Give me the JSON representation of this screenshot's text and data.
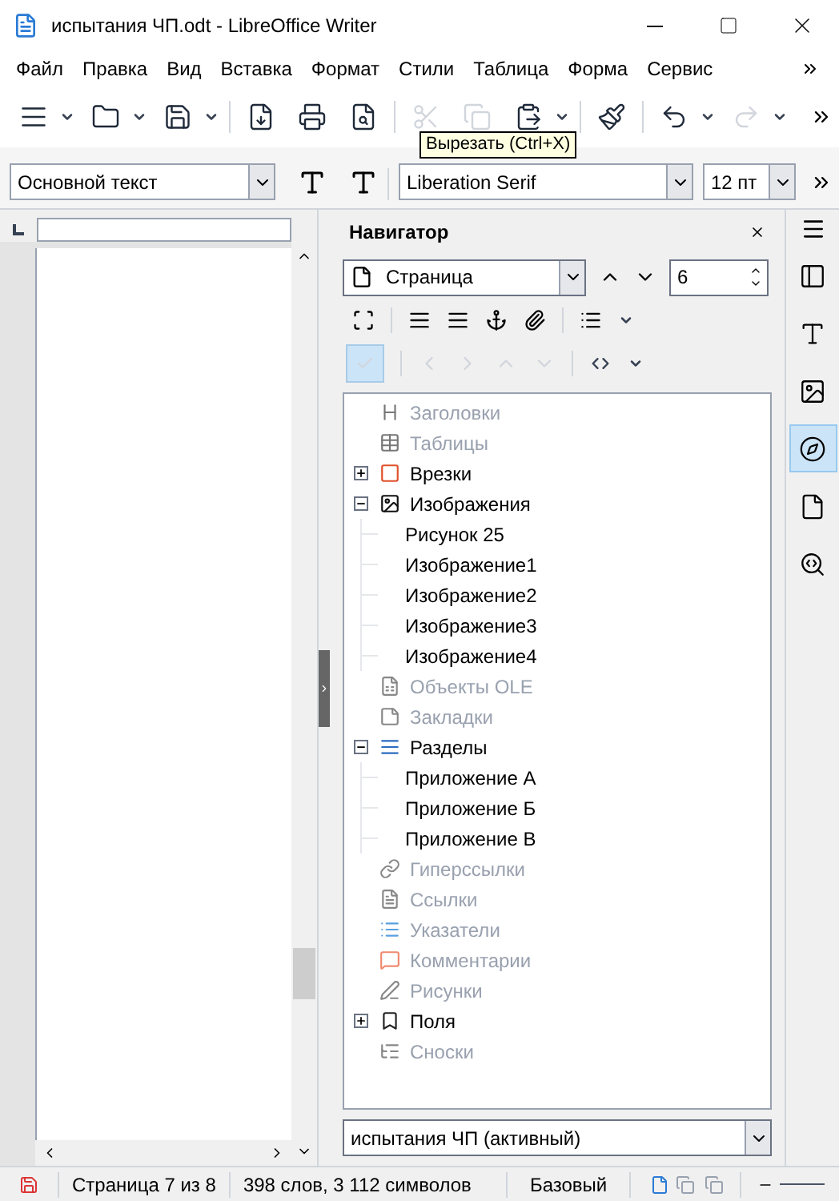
{
  "window": {
    "title": "испытания ЧП.odt - LibreOffice Writer"
  },
  "menu": [
    {
      "label": "Файл"
    },
    {
      "label": "Правка"
    },
    {
      "label": "Вид"
    },
    {
      "label": "Вставка"
    },
    {
      "label": "Формат"
    },
    {
      "label": "Стили"
    },
    {
      "label": "Таблица"
    },
    {
      "label": "Форма"
    },
    {
      "label": "Сервис"
    }
  ],
  "toolbar": [
    {
      "kind": "new",
      "dropdown": true,
      "disabled": false
    },
    {
      "kind": "open",
      "dropdown": true,
      "disabled": false
    },
    {
      "kind": "save",
      "dropdown": true,
      "disabled": false
    },
    {
      "kind": "sep"
    },
    {
      "kind": "pdf",
      "dropdown": false,
      "disabled": false
    },
    {
      "kind": "print",
      "dropdown": false,
      "disabled": false
    },
    {
      "kind": "preview",
      "dropdown": false,
      "disabled": false
    },
    {
      "kind": "sep"
    },
    {
      "kind": "cut",
      "dropdown": false,
      "disabled": true
    },
    {
      "kind": "copy",
      "dropdown": false,
      "disabled": true
    },
    {
      "kind": "paste",
      "dropdown": true,
      "disabled": false
    },
    {
      "kind": "sep"
    },
    {
      "kind": "brush",
      "dropdown": false,
      "disabled": false
    },
    {
      "kind": "sep"
    },
    {
      "kind": "undo",
      "dropdown": true,
      "disabled": false
    },
    {
      "kind": "redo",
      "dropdown": true,
      "disabled": true
    }
  ],
  "tooltip": "Вырезать (Ctrl+X)",
  "format_bar": {
    "style": "Основной текст",
    "font": "Liberation Serif",
    "size": "12 пт"
  },
  "navigator": {
    "title": "Навигатор",
    "navigate_by": "Страница",
    "page_number": "6",
    "tree": [
      {
        "label": "Заголовки",
        "kind": "headings",
        "disabled": true
      },
      {
        "label": "Таблицы",
        "kind": "tables",
        "disabled": true
      },
      {
        "label": "Врезки",
        "kind": "frames",
        "disabled": false,
        "expanded": false
      },
      {
        "label": "Изображения",
        "kind": "images",
        "disabled": false,
        "expanded": true,
        "children": [
          {
            "label": "Рисунок 25"
          },
          {
            "label": "Изображение1"
          },
          {
            "label": "Изображение2"
          },
          {
            "label": "Изображение3"
          },
          {
            "label": "Изображение4"
          }
        ]
      },
      {
        "label": "Объекты OLE",
        "kind": "ole",
        "disabled": true
      },
      {
        "label": "Закладки",
        "kind": "bookmarks",
        "disabled": true
      },
      {
        "label": "Разделы",
        "kind": "sections",
        "disabled": false,
        "expanded": true,
        "children": [
          {
            "label": "Приложение А"
          },
          {
            "label": "Приложение Б"
          },
          {
            "label": "Приложение В"
          }
        ]
      },
      {
        "label": "Гиперссылки",
        "kind": "links",
        "disabled": true
      },
      {
        "label": "Ссылки",
        "kind": "references",
        "disabled": true
      },
      {
        "label": "Указатели",
        "kind": "indexes",
        "disabled": true
      },
      {
        "label": "Комментарии",
        "kind": "comments",
        "disabled": true
      },
      {
        "label": "Рисунки",
        "kind": "drawings",
        "disabled": true
      },
      {
        "label": "Поля",
        "kind": "fields",
        "disabled": false,
        "expanded": false
      },
      {
        "label": "Сноски",
        "kind": "footnotes",
        "disabled": true
      }
    ],
    "document": "испытания ЧП (активный)"
  },
  "sidebar_tabs": [
    {
      "kind": "properties",
      "selected": false
    },
    {
      "kind": "styles",
      "selected": false
    },
    {
      "kind": "gallery",
      "selected": false
    },
    {
      "kind": "navigator",
      "selected": true
    },
    {
      "kind": "page",
      "selected": false
    },
    {
      "kind": "inspector",
      "selected": false
    }
  ],
  "status_bar": {
    "page": "Страница 7 из 8",
    "words": "398 слов, 3 112 символов",
    "page_style": "Базовый"
  }
}
